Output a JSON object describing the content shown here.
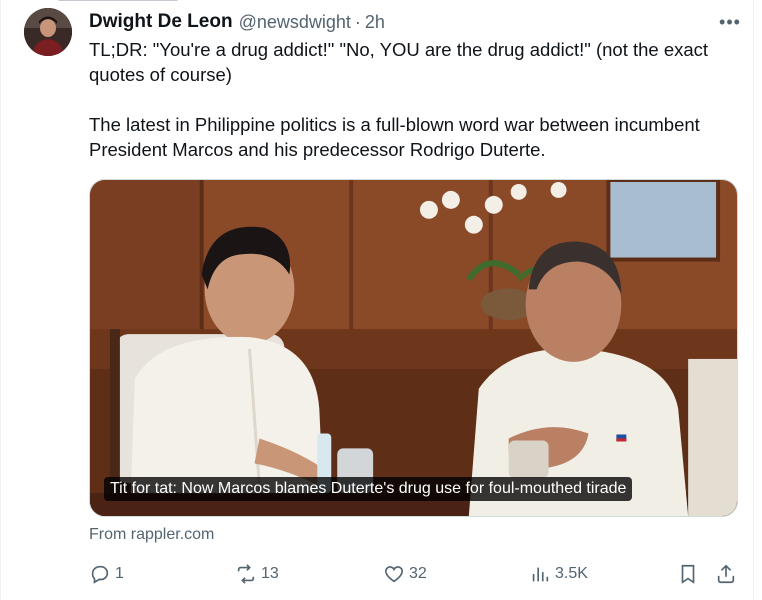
{
  "author": {
    "name": "Dwight De Leon",
    "handle": "@newsdwight",
    "separator": "·",
    "time": "2h"
  },
  "more_label": "•••",
  "tweet": {
    "paragraph1": "TL;DR: \"You're a drug addict!\" \"No, YOU are the drug addict!\" (not the exact quotes of course)",
    "paragraph2": "The latest in Philippine politics is a full-blown word war between incumbent President Marcos and his predecessor Rodrigo Duterte."
  },
  "media": {
    "caption": "Tit for tat: Now Marcos blames Duterte's drug use for foul-mouthed tirade"
  },
  "source": "From rappler.com",
  "actions": {
    "replies": "1",
    "reposts": "13",
    "likes": "32",
    "views": "3.5K"
  },
  "icons": {
    "reply": "reply-icon",
    "repost": "repost-icon",
    "like": "heart-icon",
    "views": "analytics-icon",
    "bookmark": "bookmark-icon",
    "share": "share-icon"
  }
}
